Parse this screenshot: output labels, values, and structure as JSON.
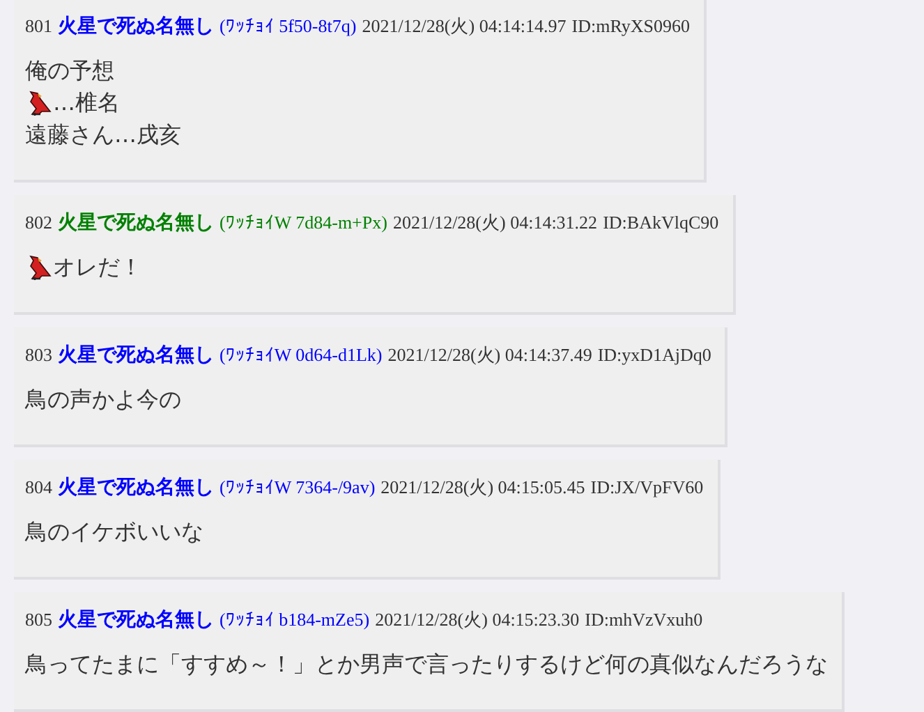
{
  "posts": [
    {
      "number": "801",
      "name": "火星で死ぬ名無し",
      "trip": "(ﾜｯﾁｮｲ 5f50-8t7q)",
      "color": "#0000ff",
      "date": "2021/12/28(火) 04:14:14.97",
      "id": "ID:mRyXS0960",
      "lines": [
        {
          "kind": "plain",
          "text": "俺の予想"
        },
        {
          "kind": "emoji",
          "text": "…椎名"
        },
        {
          "kind": "plain",
          "text": "遠藤さん…戌亥"
        }
      ]
    },
    {
      "number": "802",
      "name": "火星で死ぬ名無し",
      "trip": "(ﾜｯﾁｮｲW 7d84-m+Px)",
      "color": "#008000",
      "date": "2021/12/28(火) 04:14:31.22",
      "id": "ID:BAkVlqC90",
      "lines": [
        {
          "kind": "emoji",
          "text": "オレだ！"
        }
      ]
    },
    {
      "number": "803",
      "name": "火星で死ぬ名無し",
      "trip": "(ﾜｯﾁｮｲW 0d64-d1Lk)",
      "color": "#0000ff",
      "date": "2021/12/28(火) 04:14:37.49",
      "id": "ID:yxD1AjDq0",
      "lines": [
        {
          "kind": "plain",
          "text": "鳥の声かよ今の"
        }
      ]
    },
    {
      "number": "804",
      "name": "火星で死ぬ名無し",
      "trip": "(ﾜｯﾁｮｲW 7364-/9av)",
      "color": "#0000ff",
      "date": "2021/12/28(火) 04:15:05.45",
      "id": "ID:JX/VpFV60",
      "lines": [
        {
          "kind": "plain",
          "text": "鳥のイケボいいな"
        }
      ]
    },
    {
      "number": "805",
      "name": "火星で死ぬ名無し",
      "trip": "(ﾜｯﾁｮｲ b184-mZe5)",
      "color": "#0000ff",
      "date": "2021/12/28(火) 04:15:23.30",
      "id": "ID:mhVzVxuh0",
      "lines": [
        {
          "kind": "plain",
          "text": "鳥ってたまに「すすめ～！」とか男声で言ったりするけど何の真似なんだろうな"
        }
      ]
    }
  ]
}
